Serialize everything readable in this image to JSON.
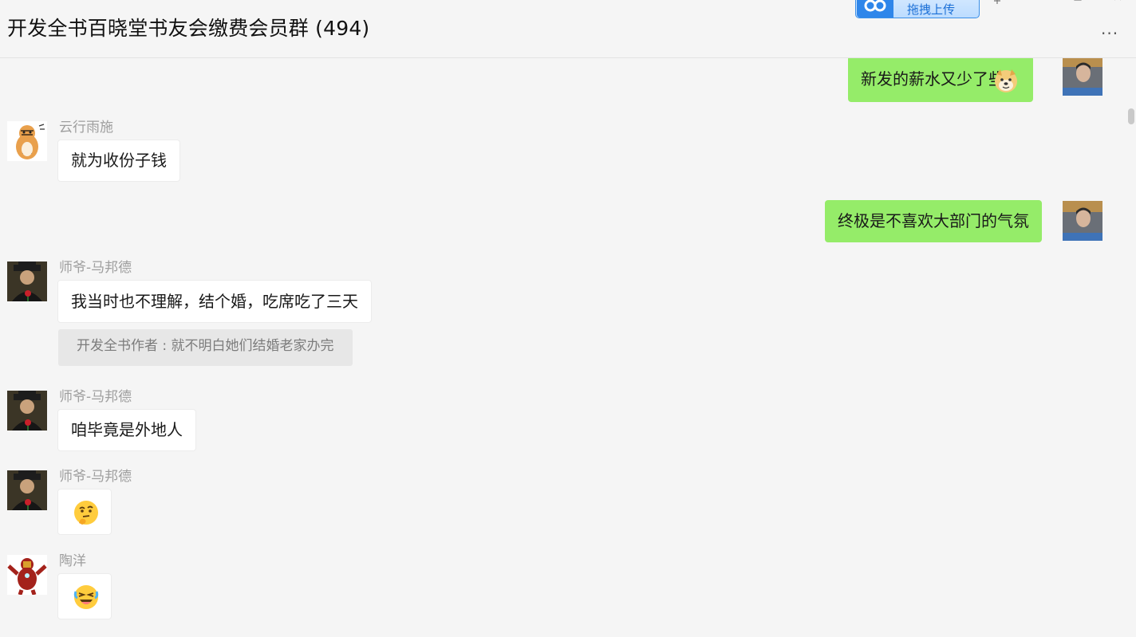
{
  "header": {
    "title": "开发全书百晓堂书友会缴费会员群 (494)",
    "upload_button": {
      "label": "拖拽上传",
      "icon": "cloud-link-icon"
    },
    "window_controls": [
      "pin-icon",
      "minimize-icon",
      "maximize-icon",
      "close-icon"
    ],
    "more_icon": "more-dots-icon",
    "more_symbol": "···"
  },
  "colors": {
    "background": "#f5f5f5",
    "bubble_in": "#ffffff",
    "bubble_out": "#95ec69",
    "sender_name": "#9e9e9e",
    "quote_bg": "#e7e7e7",
    "upload_accent": "#2f86ea"
  },
  "messages": [
    {
      "direction": "outgoing",
      "text": "新发的薪水又少了些",
      "emoji": "doge-emoji"
    },
    {
      "direction": "incoming",
      "sender": "云行雨施",
      "text": "就为收份子钱",
      "avatar": "tiger-avatar"
    },
    {
      "direction": "outgoing",
      "text": "终极是不喜欢大部门的气氛"
    },
    {
      "direction": "incoming",
      "sender": "师爷-马邦德",
      "text": "我当时也不理解，结个婚，吃席吃了三天",
      "quote": "开发全书作者 : 就不明白她们结婚老家办完",
      "avatar": "man-with-rose-avatar"
    },
    {
      "direction": "incoming",
      "sender": "师爷-马邦德",
      "text": "咱毕竟是外地人",
      "avatar": "man-with-rose-avatar"
    },
    {
      "direction": "incoming",
      "sender": "师爷-马邦德",
      "emoji": "thinking-face-emoji",
      "avatar": "man-with-rose-avatar"
    },
    {
      "direction": "incoming",
      "sender": "陶洋",
      "emoji": "rolling-laughing-emoji",
      "avatar": "ironman-avatar"
    }
  ]
}
